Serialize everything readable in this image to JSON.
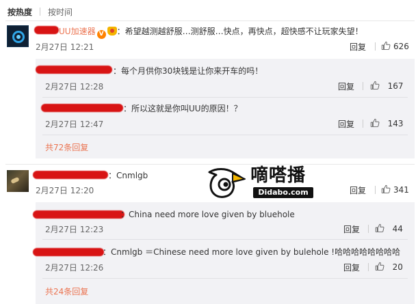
{
  "sort": {
    "hot": "按热度",
    "time": "按时间"
  },
  "comments": [
    {
      "user_suffix": "UU加速器",
      "text": "希望越测越舒服…测舒服…快点，再快点，超快感不让玩家失望！",
      "time": "2月27日 12:21",
      "reply": "回复",
      "likes": "626",
      "replies": [
        {
          "text": "每个月供你30块钱是让你来开车的吗！",
          "time": "2月27日 12:28",
          "reply": "回复",
          "likes": "167"
        },
        {
          "text": "所以这就是你叫UU的原因！？",
          "time": "2月27日 12:47",
          "reply": "回复",
          "likes": "143"
        }
      ],
      "more": "共72条回复"
    },
    {
      "text": "Cnmlgb",
      "time": "2月27日 12:20",
      "reply": "回复",
      "likes": "341",
      "replies": [
        {
          "text": "China need more love given by bluehole",
          "time": "2月27日 12:23",
          "reply": "回复",
          "likes": "44"
        },
        {
          "text": "Cnmlgb ＝Chinese need more love given by bulehole !哈哈哈哈哈哈哈哈",
          "time": "2月27日 12:26",
          "reply": "回复",
          "likes": "20"
        }
      ],
      "more": "共24条回复"
    }
  ],
  "verified_badge": "V",
  "watermark": {
    "cn": "嘀嗒播",
    "en": "Didabo.com"
  },
  "colors": {
    "accent_link": "#eb7350",
    "redaction": "#d81414",
    "verified": "#ff8200"
  },
  "icons": {
    "like": "thumbs-up-icon",
    "verified": "verified-v-icon",
    "vip": "vip-crown-icon"
  }
}
